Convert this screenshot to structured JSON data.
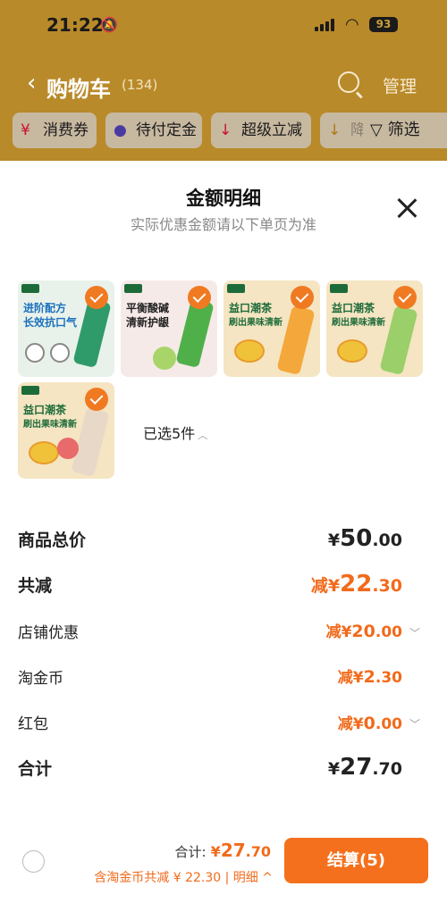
{
  "status_bar": {
    "time": "21:22",
    "battery": "93"
  },
  "nav": {
    "title": "购物车",
    "count": "(134)",
    "manage": "管理"
  },
  "filters": [
    {
      "label": "消费券",
      "icon": "¥"
    },
    {
      "label": "待付定金",
      "icon": "●"
    },
    {
      "label": "超级立减",
      "icon": "↓"
    },
    {
      "label": "降",
      "icon": "↓"
    }
  ],
  "filter_button": "筛选",
  "sheet": {
    "title": "金额明细",
    "subtitle": "实际优惠金额请以下单页为准",
    "products": [
      {
        "line1": "进阶配方",
        "line2": "长效抗口气",
        "bg": "#e9f2ea",
        "text_color": "#1a6fbf"
      },
      {
        "line1": "平衡酸碱",
        "line2": "清新护龈",
        "bg": "#f6eae8",
        "text_color": "#222222"
      },
      {
        "line1": "益口潮茶",
        "line2": "刷出果味清新",
        "bg": "#f5e5c2",
        "text_color": "#1e6b3a"
      },
      {
        "line1": "益口潮茶",
        "line2": "刷出果味清新",
        "bg": "#f5e5c2",
        "text_color": "#1e6b3a"
      },
      {
        "line1": "益口潮茶",
        "line2": "刷出果味清新",
        "bg": "#f5e5c2",
        "text_color": "#1e6b3a"
      }
    ],
    "selected_text": "已选5件",
    "rows": [
      {
        "label": "商品总价",
        "prefix": "",
        "symbol": "¥",
        "int": "50",
        "dec": ".00"
      },
      {
        "label": "共减",
        "prefix": "减",
        "symbol": "¥",
        "int": "22",
        "dec": ".30"
      },
      {
        "label": "店铺优惠",
        "prefix": "减",
        "symbol": "¥",
        "int": "20",
        "dec": ".00"
      },
      {
        "label": "淘金币",
        "prefix": "减",
        "symbol": "¥",
        "int": "2",
        "dec": ".30"
      },
      {
        "label": "红包",
        "prefix": "减",
        "symbol": "¥",
        "int": "0",
        "dec": ".00"
      },
      {
        "label": "合计",
        "prefix": "",
        "symbol": "¥",
        "int": "27",
        "dec": ".70"
      }
    ]
  },
  "bottom_bar": {
    "total_label": "合计:",
    "total_symbol": "¥",
    "total_int": "27",
    "total_dec": ".70",
    "discount_text": "含淘金币共减 ¥ 22.30 | 明细",
    "discount_chevron": "^",
    "checkout_label": "结算(5)"
  },
  "colors": {
    "accent": "#f26a1b",
    "button": "#f4701c",
    "overlay_header": "#b98a2a"
  }
}
